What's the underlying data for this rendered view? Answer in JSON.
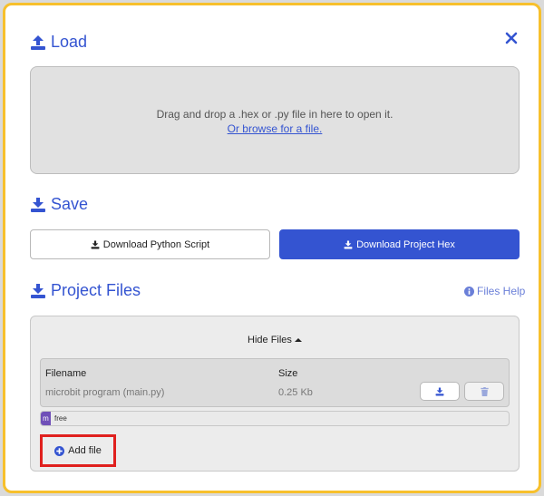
{
  "colors": {
    "accent": "#3454d1",
    "modal_border": "#f7c02c",
    "highlight": "#e0201e",
    "storage_used": "#6f4fb8"
  },
  "load": {
    "title": "Load",
    "icon": "upload-icon",
    "drop_text": "Drag and drop a .hex or .py file in here to open it.",
    "browse_link": "Or browse for a file."
  },
  "close": {
    "icon": "close-icon"
  },
  "save": {
    "title": "Save",
    "icon": "download-icon",
    "download_python_label": "Download Python Script",
    "download_hex_label": "Download Project Hex"
  },
  "project_files": {
    "title": "Project Files",
    "icon": "download-icon",
    "help_label": "Files Help",
    "toggle_label": "Hide Files",
    "columns": {
      "filename": "Filename",
      "size": "Size"
    },
    "files": [
      {
        "name": "microbit program (main.py)",
        "size": "0.25 Kb"
      }
    ],
    "storage": {
      "used_label": "m",
      "free_label": "free",
      "used_fraction": 0.02
    },
    "add_file_label": "Add file"
  }
}
